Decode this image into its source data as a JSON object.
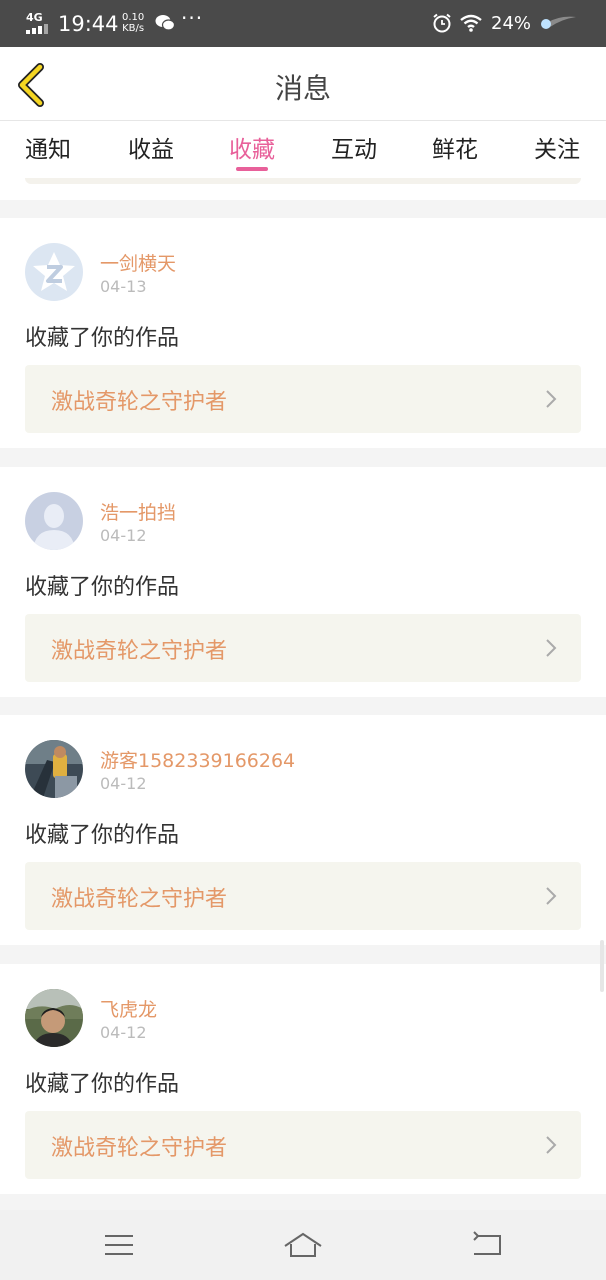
{
  "status_bar": {
    "network": "4G",
    "time": "19:44",
    "speed_value": "0.10",
    "speed_unit": "KB/s",
    "more": "···",
    "battery": "24%"
  },
  "header": {
    "title": "消息"
  },
  "tabs": [
    {
      "label": "通知",
      "active": false
    },
    {
      "label": "收益",
      "active": false
    },
    {
      "label": "收藏",
      "active": true
    },
    {
      "label": "互动",
      "active": false
    },
    {
      "label": "鲜花",
      "active": false
    },
    {
      "label": "关注",
      "active": false
    }
  ],
  "items": [
    {
      "username": "一剑横天",
      "date": "04-13",
      "action": "收藏了你的作品",
      "work": "激战奇轮之守护者",
      "avatar": "qq-default-avatar"
    },
    {
      "username": "浩一拍挡",
      "date": "04-12",
      "action": "收藏了你的作品",
      "work": "激战奇轮之守护者",
      "avatar": "default-person-avatar"
    },
    {
      "username": "游客1582339166264",
      "date": "04-12",
      "action": "收藏了你的作品",
      "work": "激战奇轮之守护者",
      "avatar": "photo-avatar"
    },
    {
      "username": "飞虎龙",
      "date": "04-12",
      "action": "收藏了你的作品",
      "work": "激战奇轮之守护者",
      "avatar": "photo-avatar"
    }
  ],
  "colors": {
    "accent": "#e8609a",
    "username": "#e49868",
    "back_arrow": "#f5d623"
  }
}
